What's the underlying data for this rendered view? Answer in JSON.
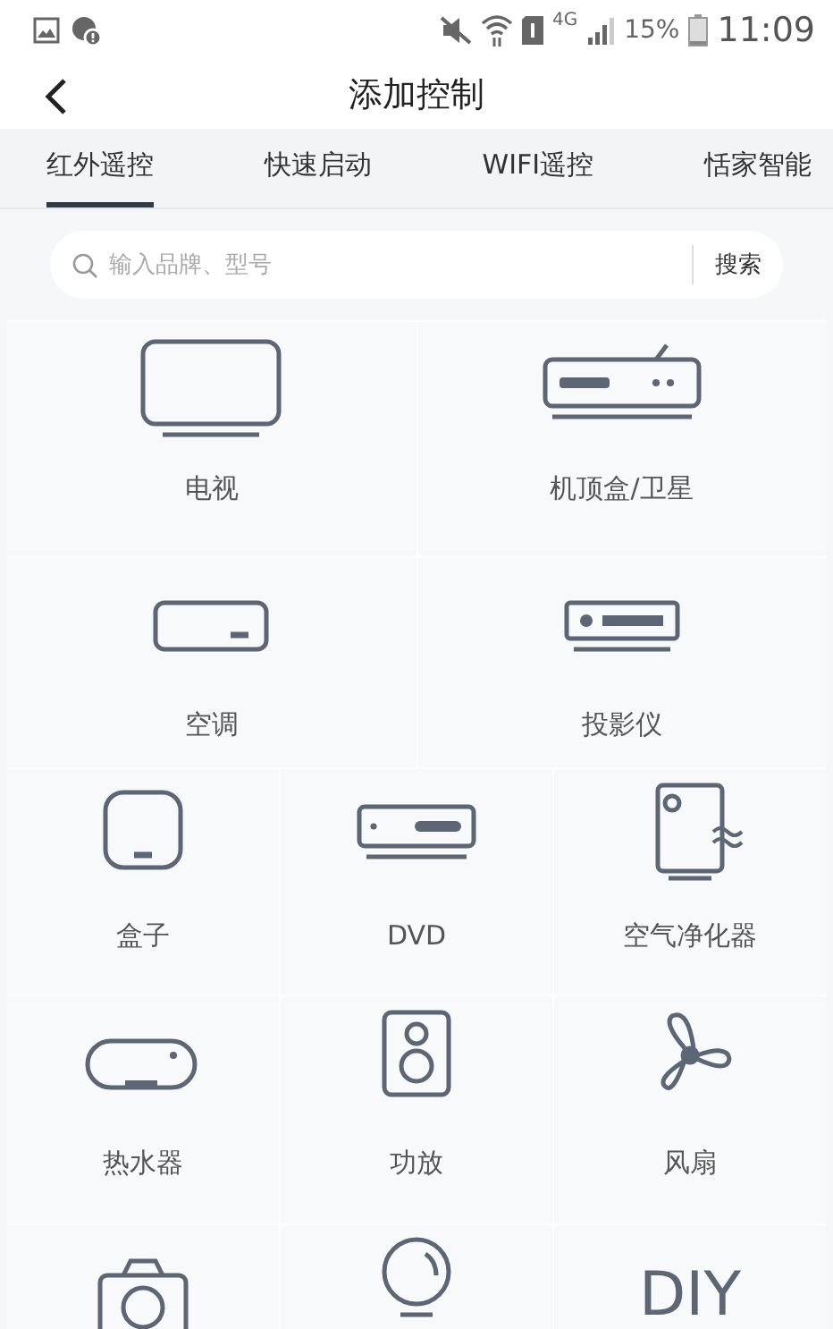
{
  "status_bar": {
    "network": "4G",
    "battery": "15%",
    "time": "11:09"
  },
  "header": {
    "title": "添加控制"
  },
  "tabs": [
    {
      "label": "红外遥控",
      "selected": true
    },
    {
      "label": "快速启动",
      "selected": false
    },
    {
      "label": "WIFI遥控",
      "selected": false
    },
    {
      "label": "恬家智能",
      "selected": false
    }
  ],
  "search": {
    "placeholder": "输入品牌、型号",
    "button": "搜索"
  },
  "device_rows": [
    {
      "items": [
        {
          "kind": "tv",
          "label": "电视"
        },
        {
          "kind": "settop",
          "label": "机顶盒/卫星"
        }
      ]
    },
    {
      "items": [
        {
          "kind": "ac",
          "label": "空调"
        },
        {
          "kind": "projector",
          "label": "投影仪"
        }
      ]
    },
    {
      "items": [
        {
          "kind": "box",
          "label": "盒子"
        },
        {
          "kind": "dvd",
          "label": "DVD"
        },
        {
          "kind": "purifier",
          "label": "空气净化器"
        }
      ]
    },
    {
      "items": [
        {
          "kind": "heater",
          "label": "热水器"
        },
        {
          "kind": "speaker",
          "label": "功放"
        },
        {
          "kind": "fan",
          "label": "风扇"
        }
      ]
    },
    {
      "items": [
        {
          "kind": "camera"
        },
        {
          "kind": "bulb"
        },
        {
          "kind": "text",
          "glyph": "DIY"
        }
      ]
    }
  ]
}
